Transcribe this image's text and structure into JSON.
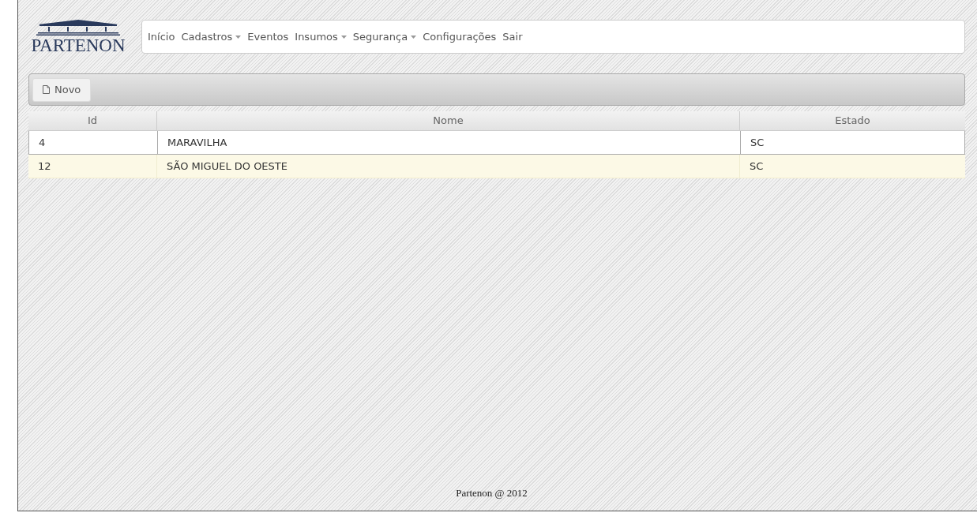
{
  "logo": {
    "text": "PARTENON"
  },
  "nav": [
    {
      "label": "Início",
      "dropdown": false
    },
    {
      "label": "Cadastros",
      "dropdown": true
    },
    {
      "label": "Eventos",
      "dropdown": false
    },
    {
      "label": "Insumos",
      "dropdown": true
    },
    {
      "label": "Segurança",
      "dropdown": true
    },
    {
      "label": "Configurações",
      "dropdown": false
    },
    {
      "label": "Sair",
      "dropdown": false
    }
  ],
  "toolbar": {
    "new_button": "Novo"
  },
  "table": {
    "columns": [
      "Id",
      "Nome",
      "Estado"
    ],
    "rows": [
      {
        "cells": [
          "4",
          "MARAVILHA",
          "SC"
        ],
        "selected": false
      },
      {
        "cells": [
          "12",
          "SÃO MIGUEL DO OESTE",
          "SC"
        ],
        "selected": true
      }
    ]
  },
  "footer": "Partenon @ 2012"
}
